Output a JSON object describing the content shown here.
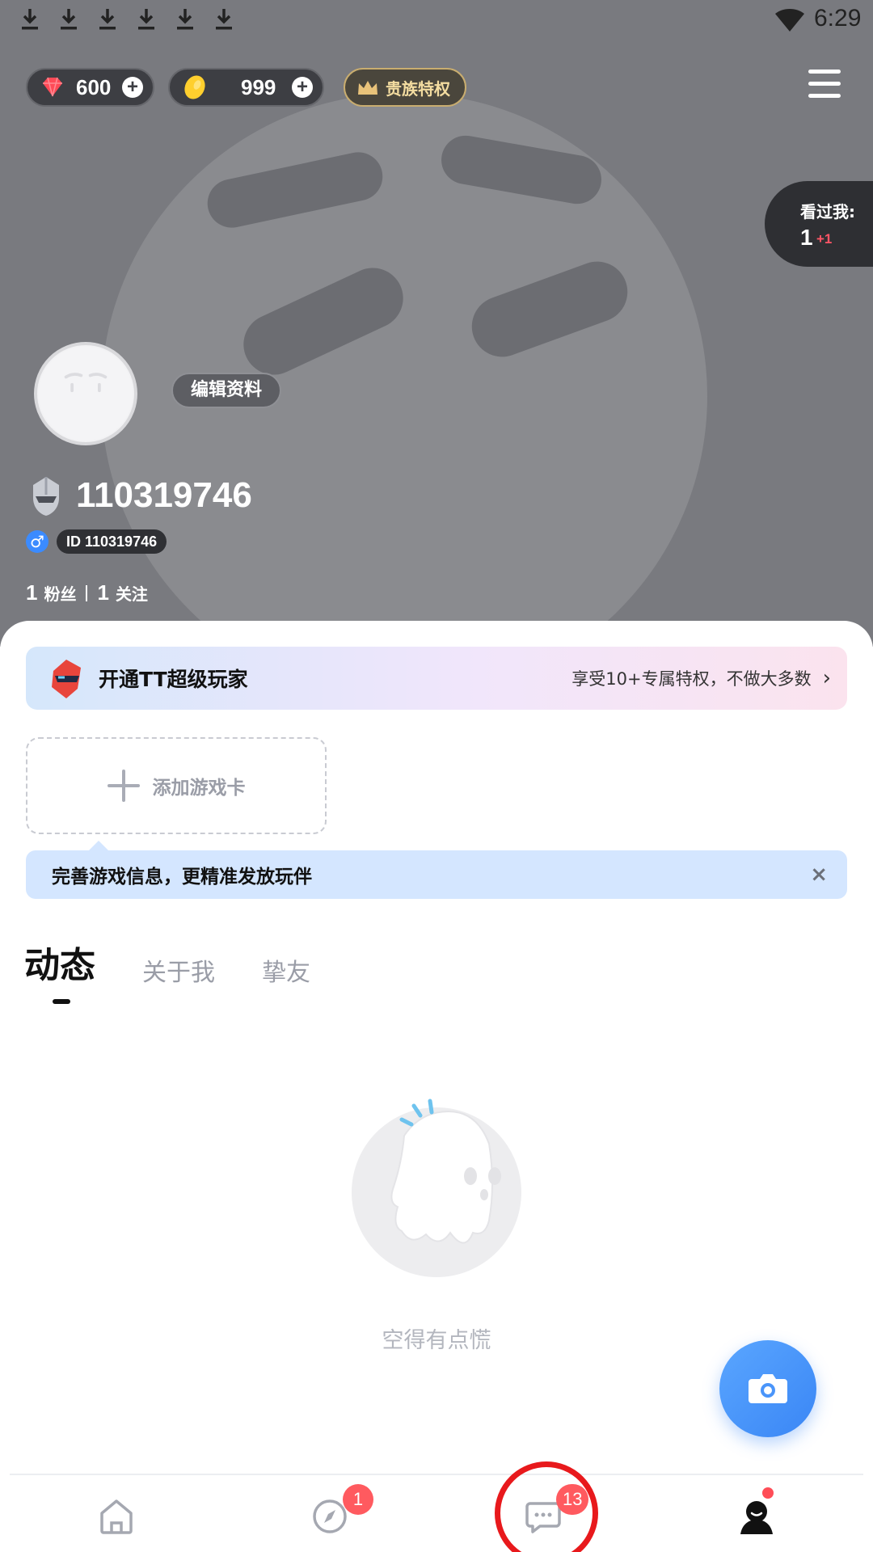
{
  "status_bar": {
    "time": "6:29",
    "download_icons": 6
  },
  "currency": {
    "gems": "600",
    "coins": "999",
    "noble_label": "贵族特权"
  },
  "visitors": {
    "label": "看过我:",
    "count": "1",
    "new": "+1"
  },
  "profile": {
    "edit_label": "编辑资料",
    "nickname": "110319746",
    "gender_symbol": "♂",
    "id_label": "ID 110319746",
    "fans_count": "1",
    "fans_label": "粉丝",
    "following_count": "1",
    "following_label": "关注"
  },
  "super_banner": {
    "title": "开通TT超级玩家",
    "desc": "享受10+专属特权，不做大多数",
    "chevron": "›"
  },
  "game_card": {
    "add_label": "添加游戏卡"
  },
  "tip": {
    "text": "完善游戏信息，更精准发放玩伴",
    "close": "×"
  },
  "tabs": [
    {
      "label": "动态"
    },
    {
      "label": "关于我"
    },
    {
      "label": "挚友"
    }
  ],
  "empty_state": {
    "text": "空得有点慌"
  },
  "bottom_nav": {
    "items": [
      {
        "name": "home",
        "icon": "home-icon",
        "badge": ""
      },
      {
        "name": "discover",
        "icon": "compass-icon",
        "badge": "1"
      },
      {
        "name": "messages",
        "icon": "chat-icon",
        "badge": "13"
      },
      {
        "name": "me",
        "icon": "person-icon",
        "badge": ""
      }
    ]
  },
  "colors": {
    "accent_blue": "#3b8bff",
    "badge_red": "#ff5a5f",
    "annotation_red": "#e8191c",
    "header_gray": "#797a7f"
  }
}
